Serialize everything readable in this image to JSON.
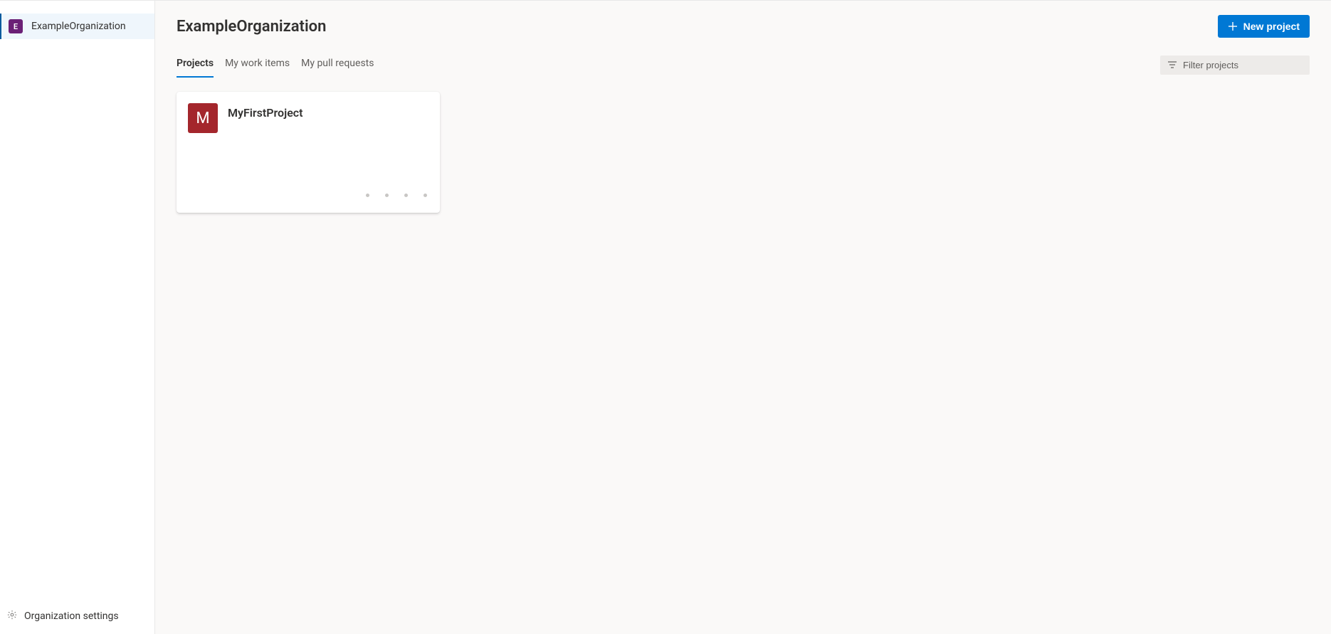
{
  "sidebar": {
    "org": {
      "icon_letter": "E",
      "icon_bg": "#6b2076",
      "label": "ExampleOrganization"
    },
    "settings_label": "Organization settings"
  },
  "header": {
    "title": "ExampleOrganization",
    "new_project_label": "New project"
  },
  "tabs": [
    {
      "label": "Projects",
      "active": true
    },
    {
      "label": "My work items",
      "active": false
    },
    {
      "label": "My pull requests",
      "active": false
    }
  ],
  "filter": {
    "placeholder": "Filter projects"
  },
  "projects": [
    {
      "name": "MyFirstProject",
      "icon_letter": "M",
      "icon_bg": "#a4262c"
    }
  ]
}
